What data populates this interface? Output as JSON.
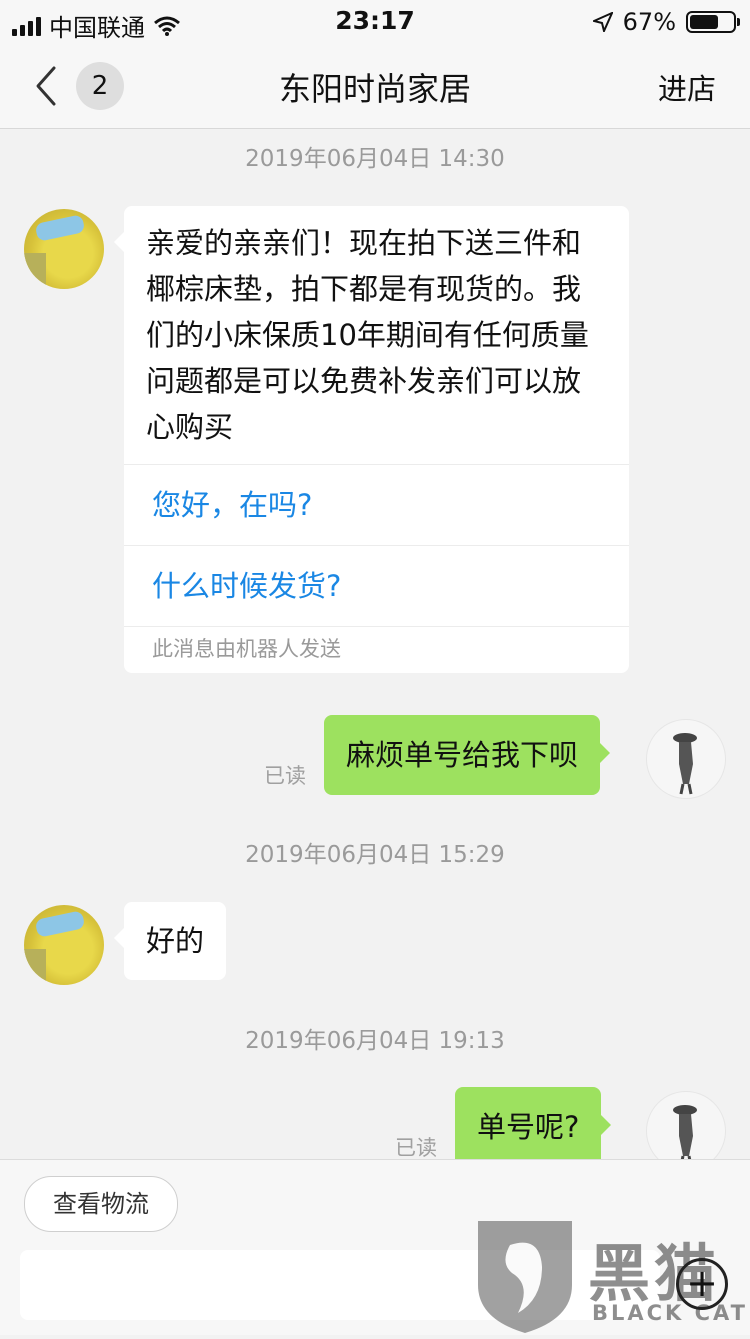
{
  "status_bar": {
    "carrier": "中国联通",
    "time": "23:17",
    "battery_percent": "67%",
    "battery_level": 0.67,
    "icons": [
      "signal-icon",
      "wifi-icon",
      "location-icon",
      "battery-icon"
    ]
  },
  "nav": {
    "back_icon": "chevron-left-icon",
    "badge_count": "2",
    "title": "东阳时尚家居",
    "store_label": "进店"
  },
  "messages": {
    "ts1": "2019年06月04日 14:30",
    "shop_msg1": "亲爱的亲亲们！现在拍下送三件和椰棕床垫，拍下都是有现货的。我们的小床保质10年期间有任何质量问题都是可以免费补发亲们可以放心购买",
    "quick_replies": [
      "您好，在吗?",
      "什么时候发货?"
    ],
    "robot_note": "此消息由机器人发送",
    "me_msg1": "麻烦单号给我下呗",
    "read1": "已读",
    "ts2": "2019年06月04日 15:29",
    "shop_msg2": "好的",
    "ts3": "2019年06月04日 19:13",
    "me_msg2": "单号呢?",
    "read2": "已读"
  },
  "bottom": {
    "logistics_label": "查看物流",
    "plus_icon": "plus-circle-icon",
    "input_value": ""
  },
  "watermark": {
    "text": "黑猫",
    "sub": "BLACK CAT"
  },
  "colors": {
    "accent_blue": "#1a87e4",
    "my_bubble": "#9de15f",
    "background": "#f2f2f2"
  }
}
